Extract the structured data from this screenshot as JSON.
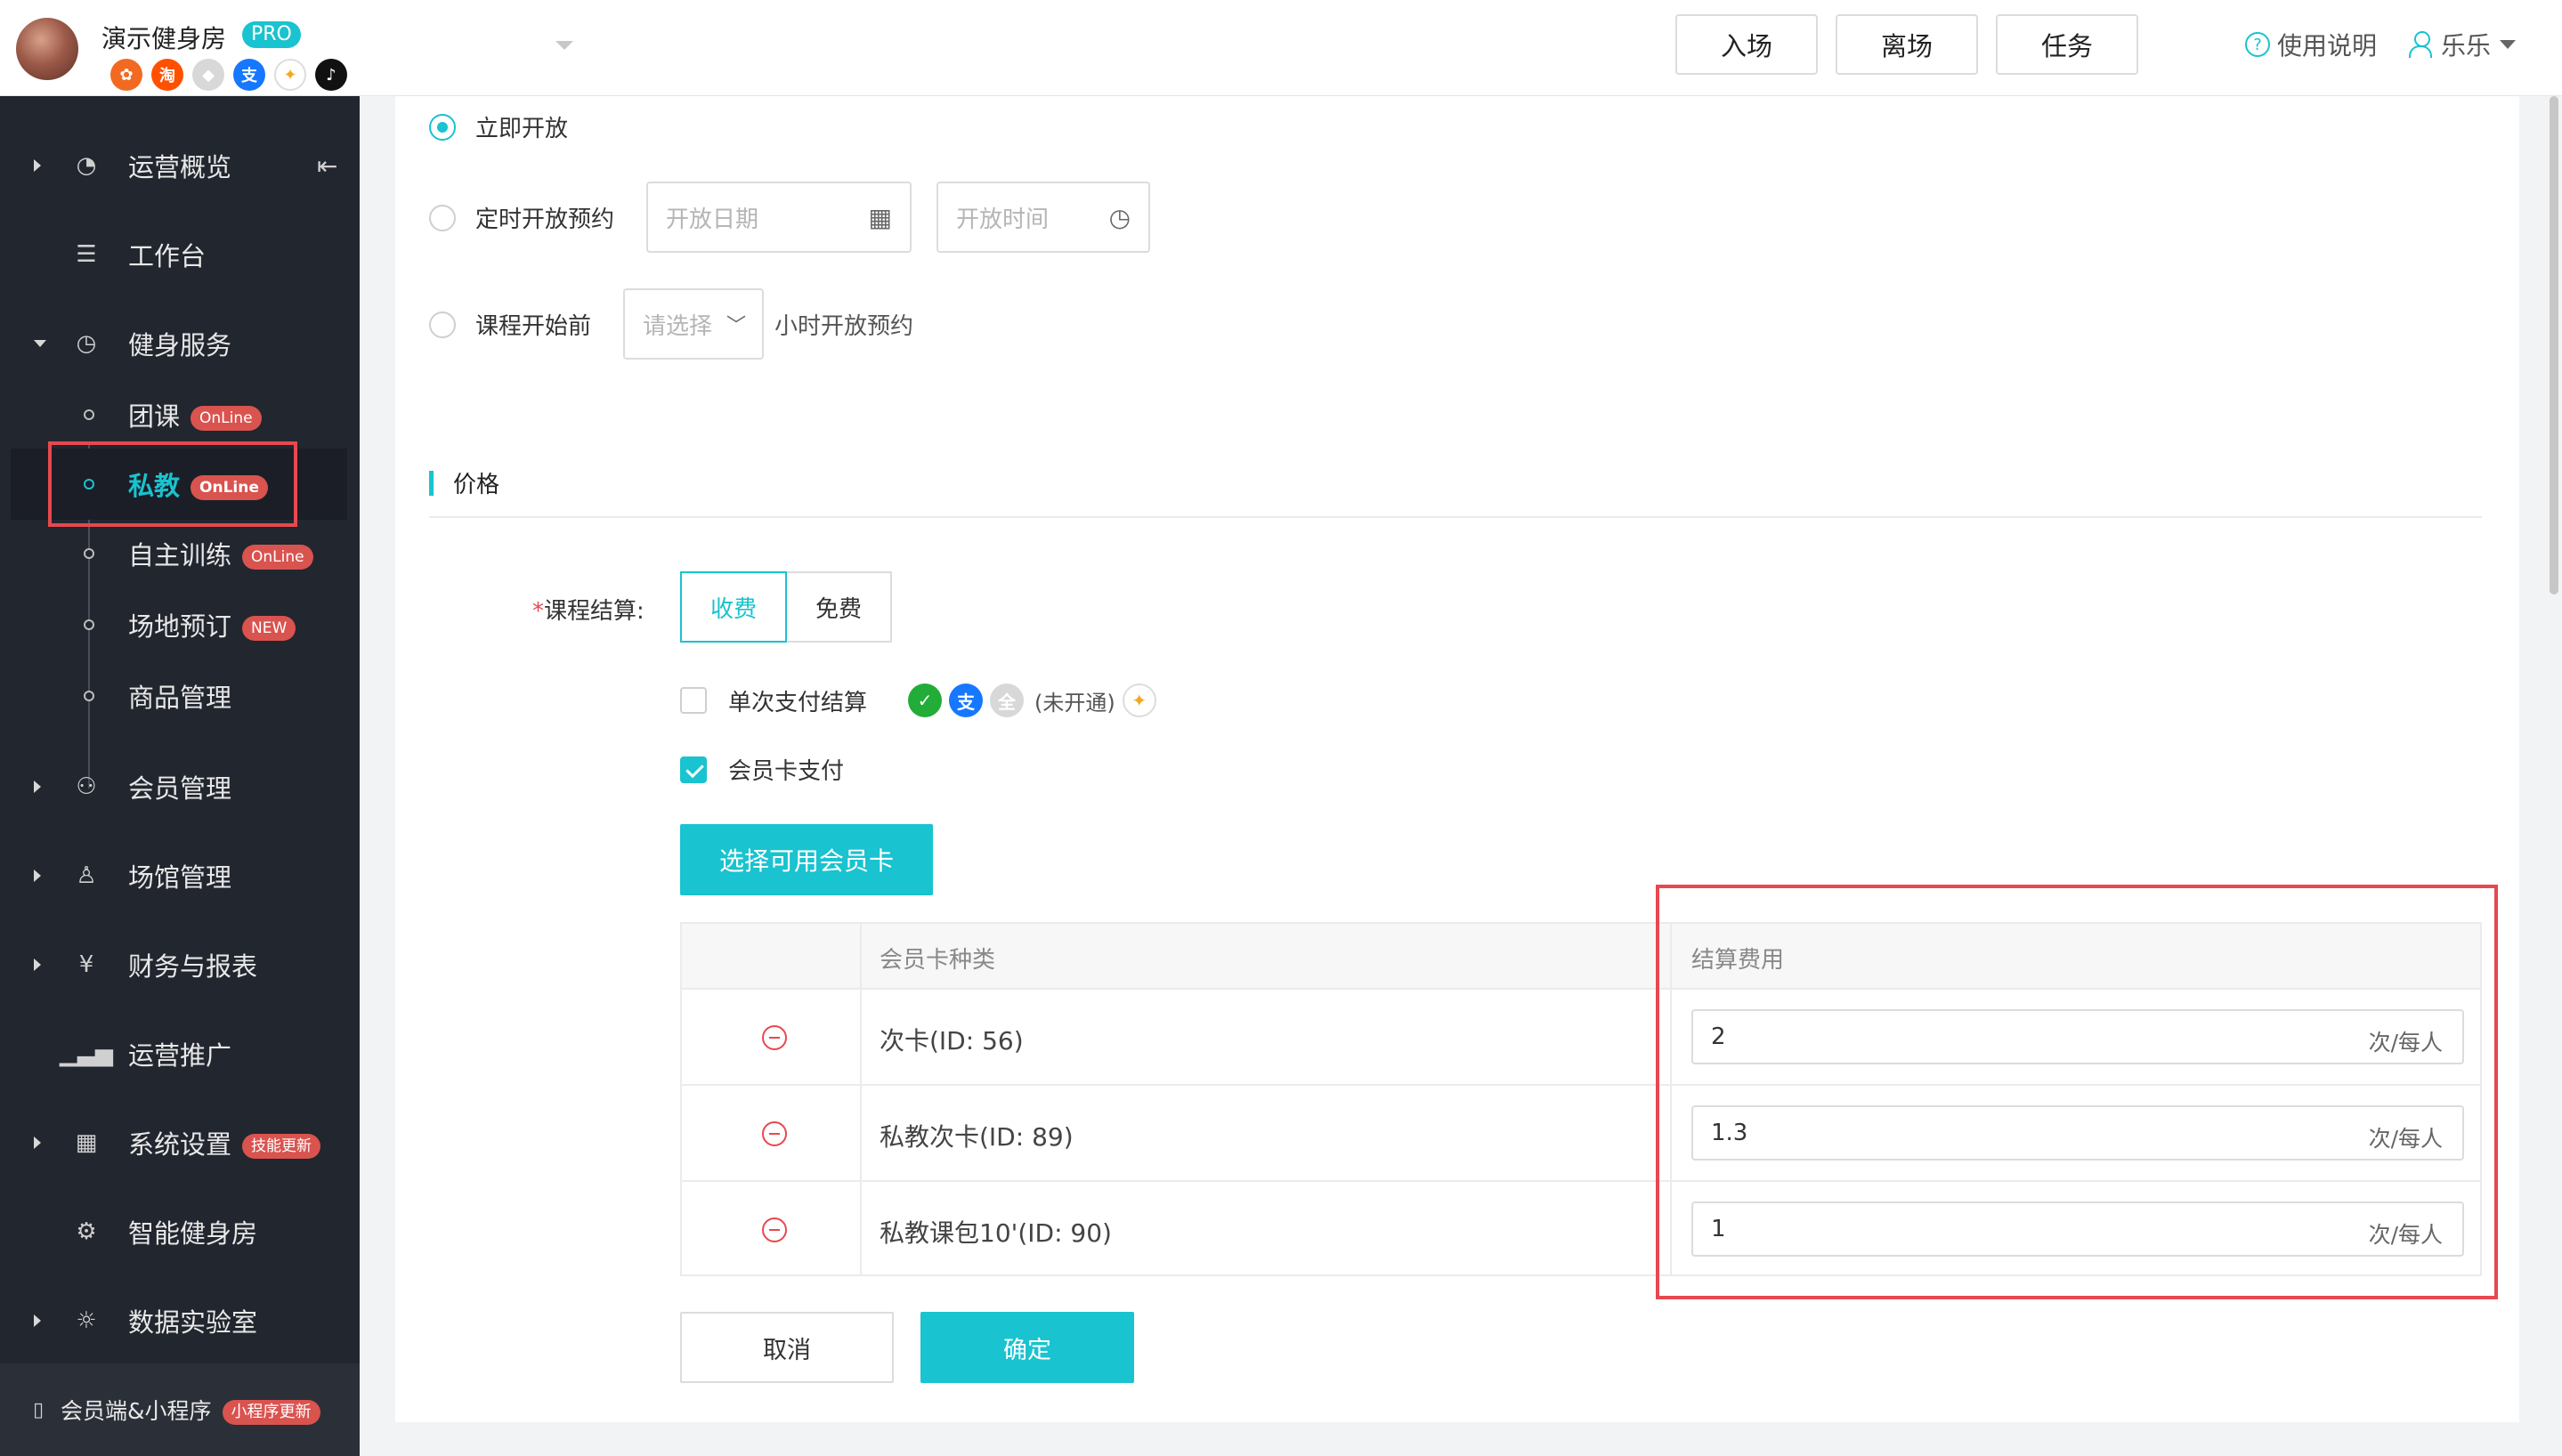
{
  "header": {
    "gym_name": "演示健身房",
    "pro_badge": "PRO",
    "app_icons": [
      {
        "name": "meituan-icon",
        "glyph": "✿",
        "color": "#f26a21"
      },
      {
        "name": "taobao-icon",
        "glyph": "淘",
        "color": "#ff5000"
      },
      {
        "name": "shield-app-icon",
        "glyph": "◆",
        "color": "#d8d8d8"
      },
      {
        "name": "alipay-icon",
        "glyph": "支",
        "color": "#1677ff"
      },
      {
        "name": "colorful-app-icon",
        "glyph": "✦",
        "color": "#f5a623"
      },
      {
        "name": "tiktok-icon",
        "glyph": "♪",
        "color": "#111111"
      }
    ],
    "buttons": {
      "enter": "入场",
      "leave": "离场",
      "tasks": "任务"
    },
    "help": "使用说明",
    "user": "乐乐"
  },
  "sidebar": {
    "items": {
      "overview": "运营概览",
      "workbench": "工作台",
      "fitness": "健身服务",
      "members": "会员管理",
      "venue": "场馆管理",
      "finance": "财务与报表",
      "promotion": "运营推广",
      "settings": "系统设置",
      "smart_gym": "智能健身房",
      "data_lab": "数据实验室"
    },
    "sub_items": {
      "group_class": "团课",
      "personal_training": "私教",
      "self_training": "自主训练",
      "venue_booking": "场地预订",
      "goods": "商品管理"
    },
    "tags": {
      "online": "OnLine",
      "new": "NEW",
      "skill_update": "技能更新",
      "miniprogram_update": "小程序更新"
    },
    "bottom": "会员端&小程序"
  },
  "booking": {
    "open_now": "立即开放",
    "scheduled": "定时开放预约",
    "date_placeholder": "开放日期",
    "time_placeholder": "开放时间",
    "before_course": "课程开始前",
    "select_placeholder": "请选择",
    "hours_suffix": "小时开放预约"
  },
  "price": {
    "section_title": "价格",
    "settlement_label": "课程结算:",
    "required_mark": "*",
    "charge": "收费",
    "free": "免费",
    "single_pay": "单次支付结算",
    "not_opened": "(未开通)",
    "card_pay": "会员卡支付",
    "select_cards_btn": "选择可用会员卡",
    "table": {
      "col_card_type": "会员卡种类",
      "col_fee": "结算费用",
      "unit": "次/每人",
      "rows": [
        {
          "card": "次卡(ID: 56)",
          "fee": "2"
        },
        {
          "card": "私教次卡(ID: 89)",
          "fee": "1.3"
        },
        {
          "card": "私教课包10'(ID: 90)",
          "fee": "1"
        }
      ]
    },
    "cancel": "取消",
    "confirm": "确定"
  },
  "colors": {
    "accent": "#19c3cf",
    "highlight": "#e8484f",
    "sidebar_bg": "#22262f"
  }
}
